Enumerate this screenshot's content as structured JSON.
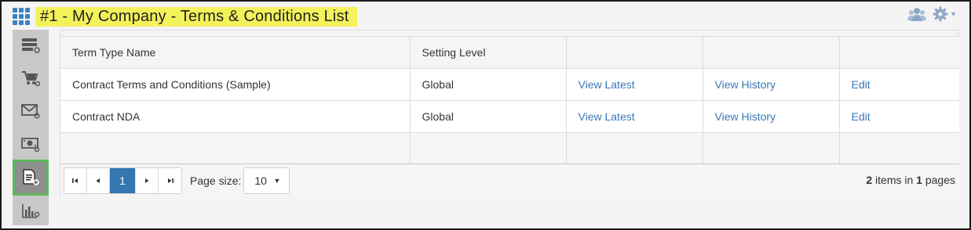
{
  "header": {
    "title": "#1 - My Company - Terms & Conditions List",
    "apps_icon": "apps-grid-icon",
    "users_icon": "users-icon",
    "settings_icon": "gear-icon"
  },
  "sidebar": {
    "items": [
      {
        "name": "servers-settings",
        "icon": "server-settings-icon",
        "active": false
      },
      {
        "name": "cart-settings",
        "icon": "cart-settings-icon",
        "active": false
      },
      {
        "name": "email-settings",
        "icon": "envelope-settings-icon",
        "active": false
      },
      {
        "name": "currency-settings",
        "icon": "money-settings-icon",
        "active": false
      },
      {
        "name": "document-settings",
        "icon": "document-settings-icon",
        "active": true
      },
      {
        "name": "report-settings",
        "icon": "chart-settings-icon",
        "active": false
      }
    ]
  },
  "table": {
    "columns": [
      "Term Type Name",
      "Setting Level",
      "",
      "",
      ""
    ],
    "rows": [
      {
        "name": "Contract Terms and Conditions (Sample)",
        "level": "Global",
        "view_latest": "View Latest",
        "view_history": "View History",
        "edit": "Edit"
      },
      {
        "name": "Contract NDA",
        "level": "Global",
        "view_latest": "View Latest",
        "view_history": "View History",
        "edit": "Edit"
      }
    ]
  },
  "pager": {
    "current_page": "1",
    "page_size_label": "Page size:",
    "page_size": "10",
    "item_count": "2",
    "items_in_text": " items in ",
    "page_count": "1",
    "pages_text": " pages"
  },
  "colors": {
    "title_highlight": "#f3f25a",
    "link": "#3a78b5",
    "active_sidebar_border": "#5cb85c",
    "pager_current": "#3576b2"
  }
}
